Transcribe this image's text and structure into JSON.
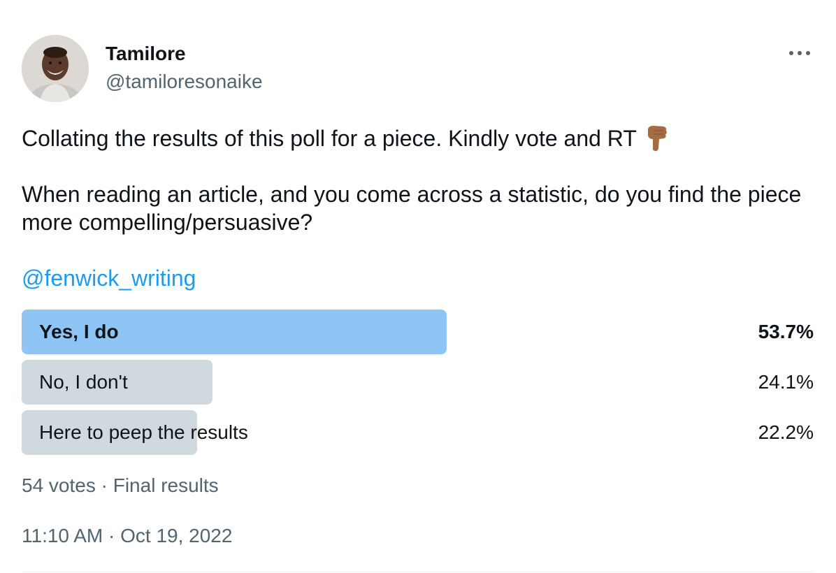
{
  "author": {
    "display_name": "Tamilore",
    "handle": "@tamiloresonaike",
    "avatar_icon": "profile-photo"
  },
  "more_icon": "more-horizontal-icon",
  "tweet": {
    "line1": "Collating the results of this poll for a piece. Kindly vote and RT",
    "emoji": "backhand-index-pointing-down",
    "line2": "When reading an article, and you come across a statistic, do you find the piece more compelling/persuasive?",
    "mention": "@fenwick_writing"
  },
  "poll": {
    "options": [
      {
        "label": "Yes, I do",
        "percent_text": "53.7%",
        "percent": 53.7,
        "winner": true
      },
      {
        "label": "No, I don't",
        "percent_text": "24.1%",
        "percent": 24.1,
        "winner": false
      },
      {
        "label": "Here to peep the results",
        "percent_text": "22.2%",
        "percent": 22.2,
        "winner": false
      }
    ],
    "meta": "54 votes · Final results"
  },
  "timestamp": "11:10 AM · Oct 19, 2022",
  "colors": {
    "winner_bar": "#8ec5f4",
    "other_bar": "#cfd9de",
    "link": "#1d9bf0",
    "secondary_text": "#536471"
  }
}
